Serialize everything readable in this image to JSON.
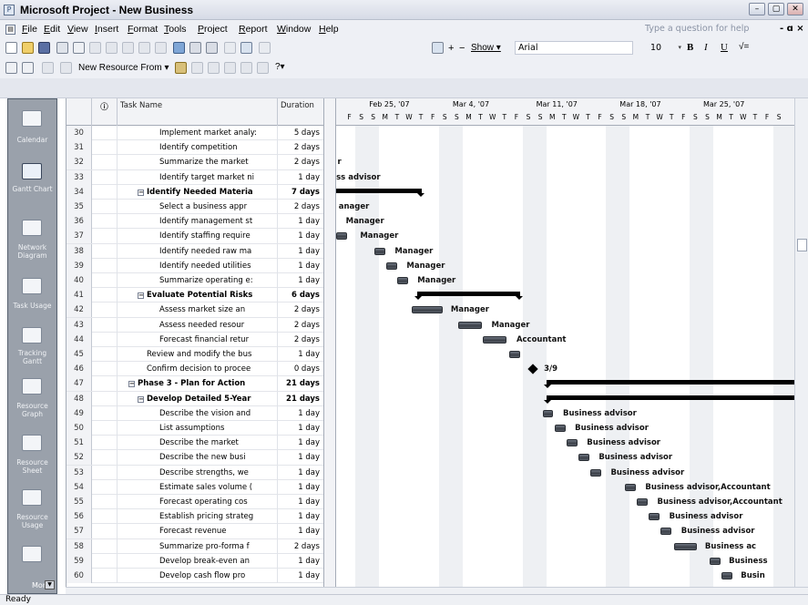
{
  "window": {
    "title": "Microsoft Project - New Business",
    "controls": [
      "minimize",
      "restore",
      "close"
    ]
  },
  "menubar": {
    "items": [
      "File",
      "Edit",
      "View",
      "Insert",
      "Format",
      "Tools",
      "Project",
      "Report",
      "Window",
      "Help"
    ],
    "help_placeholder": "Type a question for help",
    "close_glyph": "- ɑ ×"
  },
  "toolbar": {
    "show_label": "Show ▾",
    "font": "Arial",
    "font_size": "10",
    "bold": "B",
    "italic": "I",
    "underline": "U",
    "filter_label": "√=",
    "new_resource_from": "New Resource From ▾"
  },
  "viewbar": {
    "items": [
      {
        "label": "Calendar"
      },
      {
        "label": "Gantt Chart",
        "active": true
      },
      {
        "label": "Network Diagram"
      },
      {
        "label": "Task Usage"
      },
      {
        "label": "Tracking Gantt"
      },
      {
        "label": "Resource Graph"
      },
      {
        "label": "Resource Sheet"
      },
      {
        "label": "Resource Usage"
      },
      {
        "label": "More"
      }
    ]
  },
  "grid": {
    "headers": {
      "indicator": "ⓘ",
      "name": "Task Name",
      "duration": "Duration"
    },
    "rows": [
      {
        "id": "30",
        "name": "Implement market analy:",
        "duration": "5 days",
        "level": 3
      },
      {
        "id": "31",
        "name": "Identify competition",
        "duration": "2 days",
        "level": 3
      },
      {
        "id": "32",
        "name": "Summarize the market",
        "duration": "2 days",
        "level": 3
      },
      {
        "id": "33",
        "name": "Identify target market ni",
        "duration": "1 day",
        "level": 3
      },
      {
        "id": "34",
        "name": "Identify Needed Materia",
        "duration": "7 days",
        "level": 2,
        "summary": true
      },
      {
        "id": "35",
        "name": "Select a business appr",
        "duration": "2 days",
        "level": 3
      },
      {
        "id": "36",
        "name": "Identify management st",
        "duration": "1 day",
        "level": 3
      },
      {
        "id": "37",
        "name": "Identify staffing require",
        "duration": "1 day",
        "level": 3
      },
      {
        "id": "38",
        "name": "Identify needed raw ma",
        "duration": "1 day",
        "level": 3
      },
      {
        "id": "39",
        "name": "Identify needed utilities",
        "duration": "1 day",
        "level": 3
      },
      {
        "id": "40",
        "name": "Summarize operating e:",
        "duration": "1 day",
        "level": 3
      },
      {
        "id": "41",
        "name": "Evaluate Potential Risks",
        "duration": "6 days",
        "level": 2,
        "summary": true
      },
      {
        "id": "42",
        "name": "Assess market size an",
        "duration": "2 days",
        "level": 3
      },
      {
        "id": "43",
        "name": "Assess needed resour",
        "duration": "2 days",
        "level": 3
      },
      {
        "id": "44",
        "name": "Forecast financial retur",
        "duration": "2 days",
        "level": 3
      },
      {
        "id": "45",
        "name": "Review and modify the bus",
        "duration": "1 day",
        "level": 2
      },
      {
        "id": "46",
        "name": "Confirm decision to procee",
        "duration": "0 days",
        "level": 2
      },
      {
        "id": "47",
        "name": "Phase 3 - Plan for Action",
        "duration": "21 days",
        "level": 1,
        "summary": true
      },
      {
        "id": "48",
        "name": "Develop Detailed 5-Year",
        "duration": "21 days",
        "level": 2,
        "summary": true
      },
      {
        "id": "49",
        "name": "Describe the vision and",
        "duration": "1 day",
        "level": 3
      },
      {
        "id": "50",
        "name": "List assumptions",
        "duration": "1 day",
        "level": 3
      },
      {
        "id": "51",
        "name": "Describe the market",
        "duration": "1 day",
        "level": 3
      },
      {
        "id": "52",
        "name": "Describe the new busi",
        "duration": "1 day",
        "level": 3
      },
      {
        "id": "53",
        "name": "Describe strengths, we",
        "duration": "1 day",
        "level": 3
      },
      {
        "id": "54",
        "name": "Estimate sales volume (",
        "duration": "1 day",
        "level": 3
      },
      {
        "id": "55",
        "name": "Forecast operating cos",
        "duration": "1 day",
        "level": 3
      },
      {
        "id": "56",
        "name": "Establish pricing strateg",
        "duration": "1 day",
        "level": 3
      },
      {
        "id": "57",
        "name": "Forecast revenue",
        "duration": "1 day",
        "level": 3
      },
      {
        "id": "58",
        "name": "Summarize pro-forma f",
        "duration": "2 days",
        "level": 3
      },
      {
        "id": "59",
        "name": "Develop break-even an",
        "duration": "1 day",
        "level": 3
      },
      {
        "id": "60",
        "name": "Develop cash flow pro",
        "duration": "1 day",
        "level": 3
      }
    ]
  },
  "gantt": {
    "weeks": [
      "Feb 25, '07",
      "Mar 4, '07",
      "Mar 11, '07",
      "Mar 18, '07",
      "Mar 25, '07"
    ],
    "day_letters": [
      "F",
      "S",
      "S",
      "M",
      "T",
      "W",
      "T",
      "F",
      "S",
      "S",
      "M",
      "T",
      "W",
      "T",
      "F",
      "S",
      "S",
      "M",
      "T",
      "W",
      "T",
      "F",
      "S",
      "S",
      "M",
      "T",
      "W",
      "T",
      "F",
      "S",
      "S",
      "M",
      "T",
      "W",
      "T",
      "F",
      "S"
    ],
    "labels": [
      {
        "row": 32,
        "text": "r"
      },
      {
        "row": 33,
        "text": "ss advisor"
      },
      {
        "row": 35,
        "text": "anager"
      },
      {
        "row": 36,
        "text": "Manager"
      },
      {
        "row": 37,
        "text": "Manager"
      },
      {
        "row": 38,
        "text": "Manager"
      },
      {
        "row": 39,
        "text": "Manager"
      },
      {
        "row": 40,
        "text": "Manager"
      },
      {
        "row": 42,
        "text": "Manager"
      },
      {
        "row": 43,
        "text": "Manager"
      },
      {
        "row": 44,
        "text": "Accountant"
      },
      {
        "row": 46,
        "text": "3/9"
      },
      {
        "row": 49,
        "text": "Business advisor"
      },
      {
        "row": 50,
        "text": "Business advisor"
      },
      {
        "row": 51,
        "text": "Business advisor"
      },
      {
        "row": 52,
        "text": "Business advisor"
      },
      {
        "row": 53,
        "text": "Business advisor"
      },
      {
        "row": 54,
        "text": "Business advisor,Accountant"
      },
      {
        "row": 55,
        "text": "Business advisor,Accountant"
      },
      {
        "row": 56,
        "text": "Business advisor"
      },
      {
        "row": 57,
        "text": "Business advisor"
      },
      {
        "row": 58,
        "text": "Business ac"
      },
      {
        "row": 59,
        "text": "Business"
      },
      {
        "row": 60,
        "text": "Busin"
      }
    ]
  },
  "status": {
    "text": "Ready"
  },
  "colors": {
    "viewbar": "#9aa1ab",
    "bar": "#4a5058",
    "weekend": "#eef0f3"
  }
}
